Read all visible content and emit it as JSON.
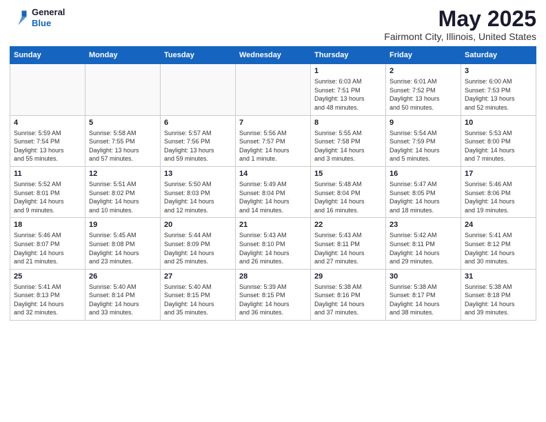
{
  "logo": {
    "general": "General",
    "blue": "Blue"
  },
  "calendar": {
    "title": "May 2025",
    "subtitle": "Fairmont City, Illinois, United States",
    "days_of_week": [
      "Sunday",
      "Monday",
      "Tuesday",
      "Wednesday",
      "Thursday",
      "Friday",
      "Saturday"
    ],
    "weeks": [
      [
        {
          "day": "",
          "info": ""
        },
        {
          "day": "",
          "info": ""
        },
        {
          "day": "",
          "info": ""
        },
        {
          "day": "",
          "info": ""
        },
        {
          "day": "1",
          "info": "Sunrise: 6:03 AM\nSunset: 7:51 PM\nDaylight: 13 hours\nand 48 minutes."
        },
        {
          "day": "2",
          "info": "Sunrise: 6:01 AM\nSunset: 7:52 PM\nDaylight: 13 hours\nand 50 minutes."
        },
        {
          "day": "3",
          "info": "Sunrise: 6:00 AM\nSunset: 7:53 PM\nDaylight: 13 hours\nand 52 minutes."
        }
      ],
      [
        {
          "day": "4",
          "info": "Sunrise: 5:59 AM\nSunset: 7:54 PM\nDaylight: 13 hours\nand 55 minutes."
        },
        {
          "day": "5",
          "info": "Sunrise: 5:58 AM\nSunset: 7:55 PM\nDaylight: 13 hours\nand 57 minutes."
        },
        {
          "day": "6",
          "info": "Sunrise: 5:57 AM\nSunset: 7:56 PM\nDaylight: 13 hours\nand 59 minutes."
        },
        {
          "day": "7",
          "info": "Sunrise: 5:56 AM\nSunset: 7:57 PM\nDaylight: 14 hours\nand 1 minute."
        },
        {
          "day": "8",
          "info": "Sunrise: 5:55 AM\nSunset: 7:58 PM\nDaylight: 14 hours\nand 3 minutes."
        },
        {
          "day": "9",
          "info": "Sunrise: 5:54 AM\nSunset: 7:59 PM\nDaylight: 14 hours\nand 5 minutes."
        },
        {
          "day": "10",
          "info": "Sunrise: 5:53 AM\nSunset: 8:00 PM\nDaylight: 14 hours\nand 7 minutes."
        }
      ],
      [
        {
          "day": "11",
          "info": "Sunrise: 5:52 AM\nSunset: 8:01 PM\nDaylight: 14 hours\nand 9 minutes."
        },
        {
          "day": "12",
          "info": "Sunrise: 5:51 AM\nSunset: 8:02 PM\nDaylight: 14 hours\nand 10 minutes."
        },
        {
          "day": "13",
          "info": "Sunrise: 5:50 AM\nSunset: 8:03 PM\nDaylight: 14 hours\nand 12 minutes."
        },
        {
          "day": "14",
          "info": "Sunrise: 5:49 AM\nSunset: 8:04 PM\nDaylight: 14 hours\nand 14 minutes."
        },
        {
          "day": "15",
          "info": "Sunrise: 5:48 AM\nSunset: 8:04 PM\nDaylight: 14 hours\nand 16 minutes."
        },
        {
          "day": "16",
          "info": "Sunrise: 5:47 AM\nSunset: 8:05 PM\nDaylight: 14 hours\nand 18 minutes."
        },
        {
          "day": "17",
          "info": "Sunrise: 5:46 AM\nSunset: 8:06 PM\nDaylight: 14 hours\nand 19 minutes."
        }
      ],
      [
        {
          "day": "18",
          "info": "Sunrise: 5:46 AM\nSunset: 8:07 PM\nDaylight: 14 hours\nand 21 minutes."
        },
        {
          "day": "19",
          "info": "Sunrise: 5:45 AM\nSunset: 8:08 PM\nDaylight: 14 hours\nand 23 minutes."
        },
        {
          "day": "20",
          "info": "Sunrise: 5:44 AM\nSunset: 8:09 PM\nDaylight: 14 hours\nand 25 minutes."
        },
        {
          "day": "21",
          "info": "Sunrise: 5:43 AM\nSunset: 8:10 PM\nDaylight: 14 hours\nand 26 minutes."
        },
        {
          "day": "22",
          "info": "Sunrise: 5:43 AM\nSunset: 8:11 PM\nDaylight: 14 hours\nand 27 minutes."
        },
        {
          "day": "23",
          "info": "Sunrise: 5:42 AM\nSunset: 8:11 PM\nDaylight: 14 hours\nand 29 minutes."
        },
        {
          "day": "24",
          "info": "Sunrise: 5:41 AM\nSunset: 8:12 PM\nDaylight: 14 hours\nand 30 minutes."
        }
      ],
      [
        {
          "day": "25",
          "info": "Sunrise: 5:41 AM\nSunset: 8:13 PM\nDaylight: 14 hours\nand 32 minutes."
        },
        {
          "day": "26",
          "info": "Sunrise: 5:40 AM\nSunset: 8:14 PM\nDaylight: 14 hours\nand 33 minutes."
        },
        {
          "day": "27",
          "info": "Sunrise: 5:40 AM\nSunset: 8:15 PM\nDaylight: 14 hours\nand 35 minutes."
        },
        {
          "day": "28",
          "info": "Sunrise: 5:39 AM\nSunset: 8:15 PM\nDaylight: 14 hours\nand 36 minutes."
        },
        {
          "day": "29",
          "info": "Sunrise: 5:38 AM\nSunset: 8:16 PM\nDaylight: 14 hours\nand 37 minutes."
        },
        {
          "day": "30",
          "info": "Sunrise: 5:38 AM\nSunset: 8:17 PM\nDaylight: 14 hours\nand 38 minutes."
        },
        {
          "day": "31",
          "info": "Sunrise: 5:38 AM\nSunset: 8:18 PM\nDaylight: 14 hours\nand 39 minutes."
        }
      ]
    ]
  }
}
